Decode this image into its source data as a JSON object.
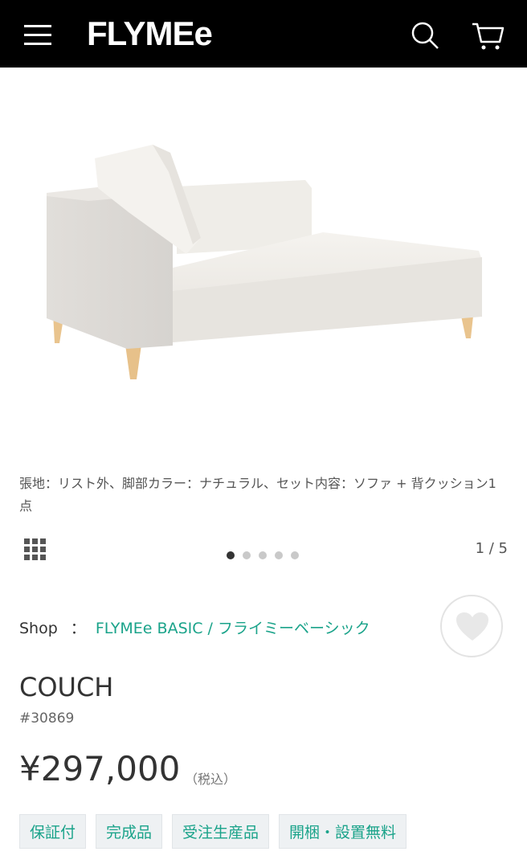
{
  "header": {
    "logo": "FLYMEe",
    "menu_icon": "menu-icon",
    "search_icon": "search-icon",
    "cart_icon": "cart-icon"
  },
  "gallery": {
    "caption": "張地：リスト外、脚部カラー：ナチュラル、セット内容：ソファ + 背クッション1点",
    "page_counter": "1 / 5",
    "dot_count": 5,
    "active_dot": 1
  },
  "product": {
    "shop_label": "Shop",
    "shop_sep": "：",
    "shop_name": "FLYMEe BASIC / フライミーベーシック",
    "name": "COUCH",
    "sku": "#30869",
    "price": "¥297,000",
    "tax_note": "（税込）",
    "tags": [
      "保証付",
      "完成品",
      "受注生産品",
      "開梱・設置無料"
    ]
  },
  "colors": {
    "accent": "#1aa38a",
    "header_bg": "#000000"
  }
}
